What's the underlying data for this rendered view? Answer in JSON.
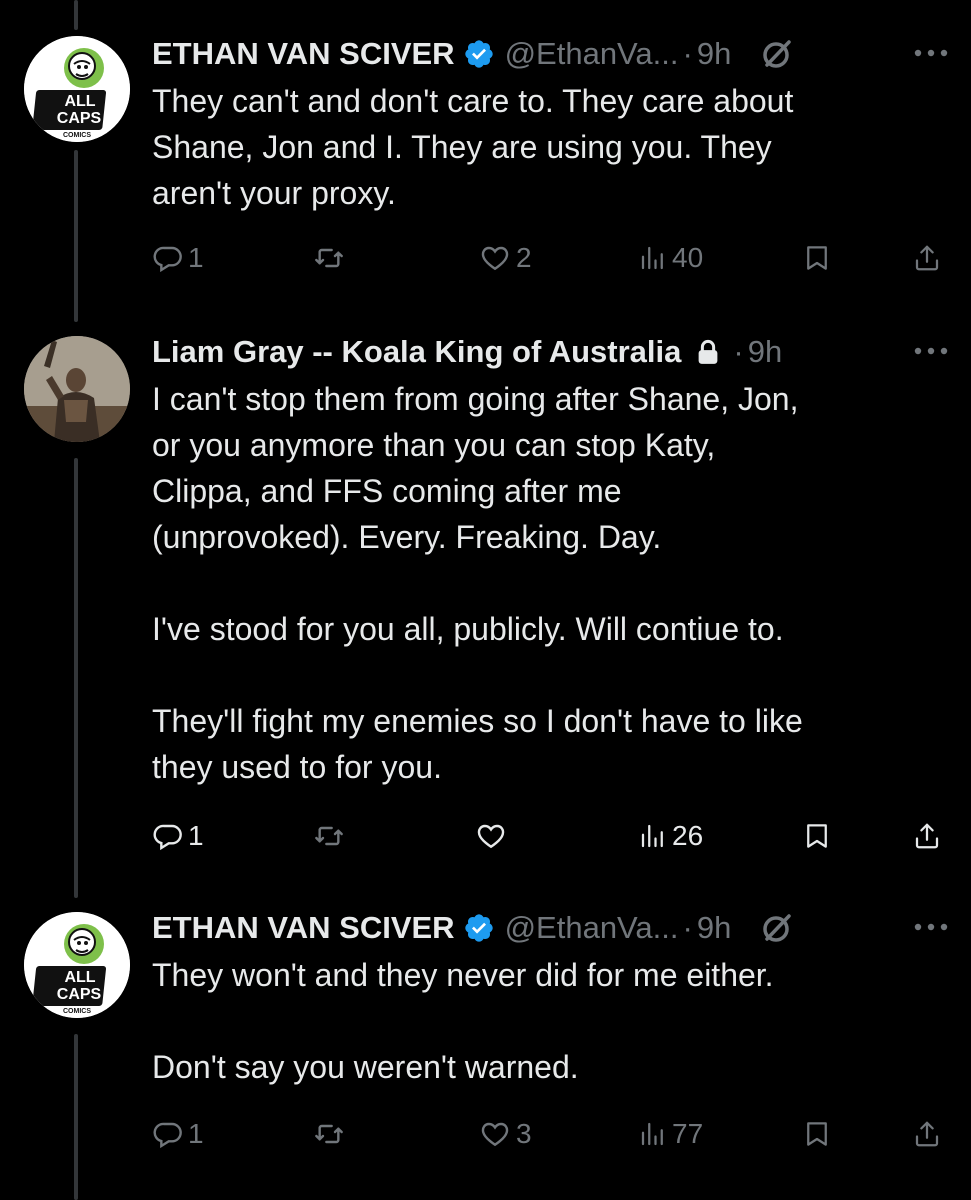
{
  "tweets": [
    {
      "name": "ETHAN VAN SCIVER",
      "handle": "@EthanVa...",
      "time": "9h",
      "verified": true,
      "locked": false,
      "avatar": "all-caps-comics-logo",
      "text": "They can't and don't care to.  They care about\nShane, Jon and I.  They are using you.  They\naren't your proxy.",
      "stats": {
        "replies": "1",
        "reposts": "",
        "likes": "2",
        "views": "40"
      }
    },
    {
      "name": "Liam Gray -- Koala King of Australia",
      "handle": "",
      "time": "9h",
      "verified": false,
      "locked": true,
      "avatar": "warrior-photo",
      "text": "I can't stop them from going after Shane, Jon,\nor you anymore than you can stop Katy,\nClippa, and FFS coming after me\n(unprovoked). Every. Freaking. Day.\n\nI've stood for you all, publicly. Will contiue to.\n\nThey'll fight my enemies so I don't have to like\nthey used to for you.",
      "stats": {
        "replies": "1",
        "reposts": "",
        "likes": "",
        "views": "26"
      }
    },
    {
      "name": "ETHAN VAN SCIVER",
      "handle": "@EthanVa...",
      "time": "9h",
      "verified": true,
      "locked": false,
      "avatar": "all-caps-comics-logo",
      "text": "They won't and they never did for me either.\n\nDon't say you weren't warned.",
      "stats": {
        "replies": "1",
        "reposts": "",
        "likes": "3",
        "views": "77"
      }
    }
  ],
  "logo": {
    "line1": "ALL",
    "line2": "CAPS",
    "line3": "COMICS"
  },
  "dot": "·",
  "colors": {
    "background": "#000000",
    "text": "#e7e9ea",
    "muted": "#71767b",
    "verified": "#1d9bf0",
    "logo_green": "#7ec04a"
  }
}
